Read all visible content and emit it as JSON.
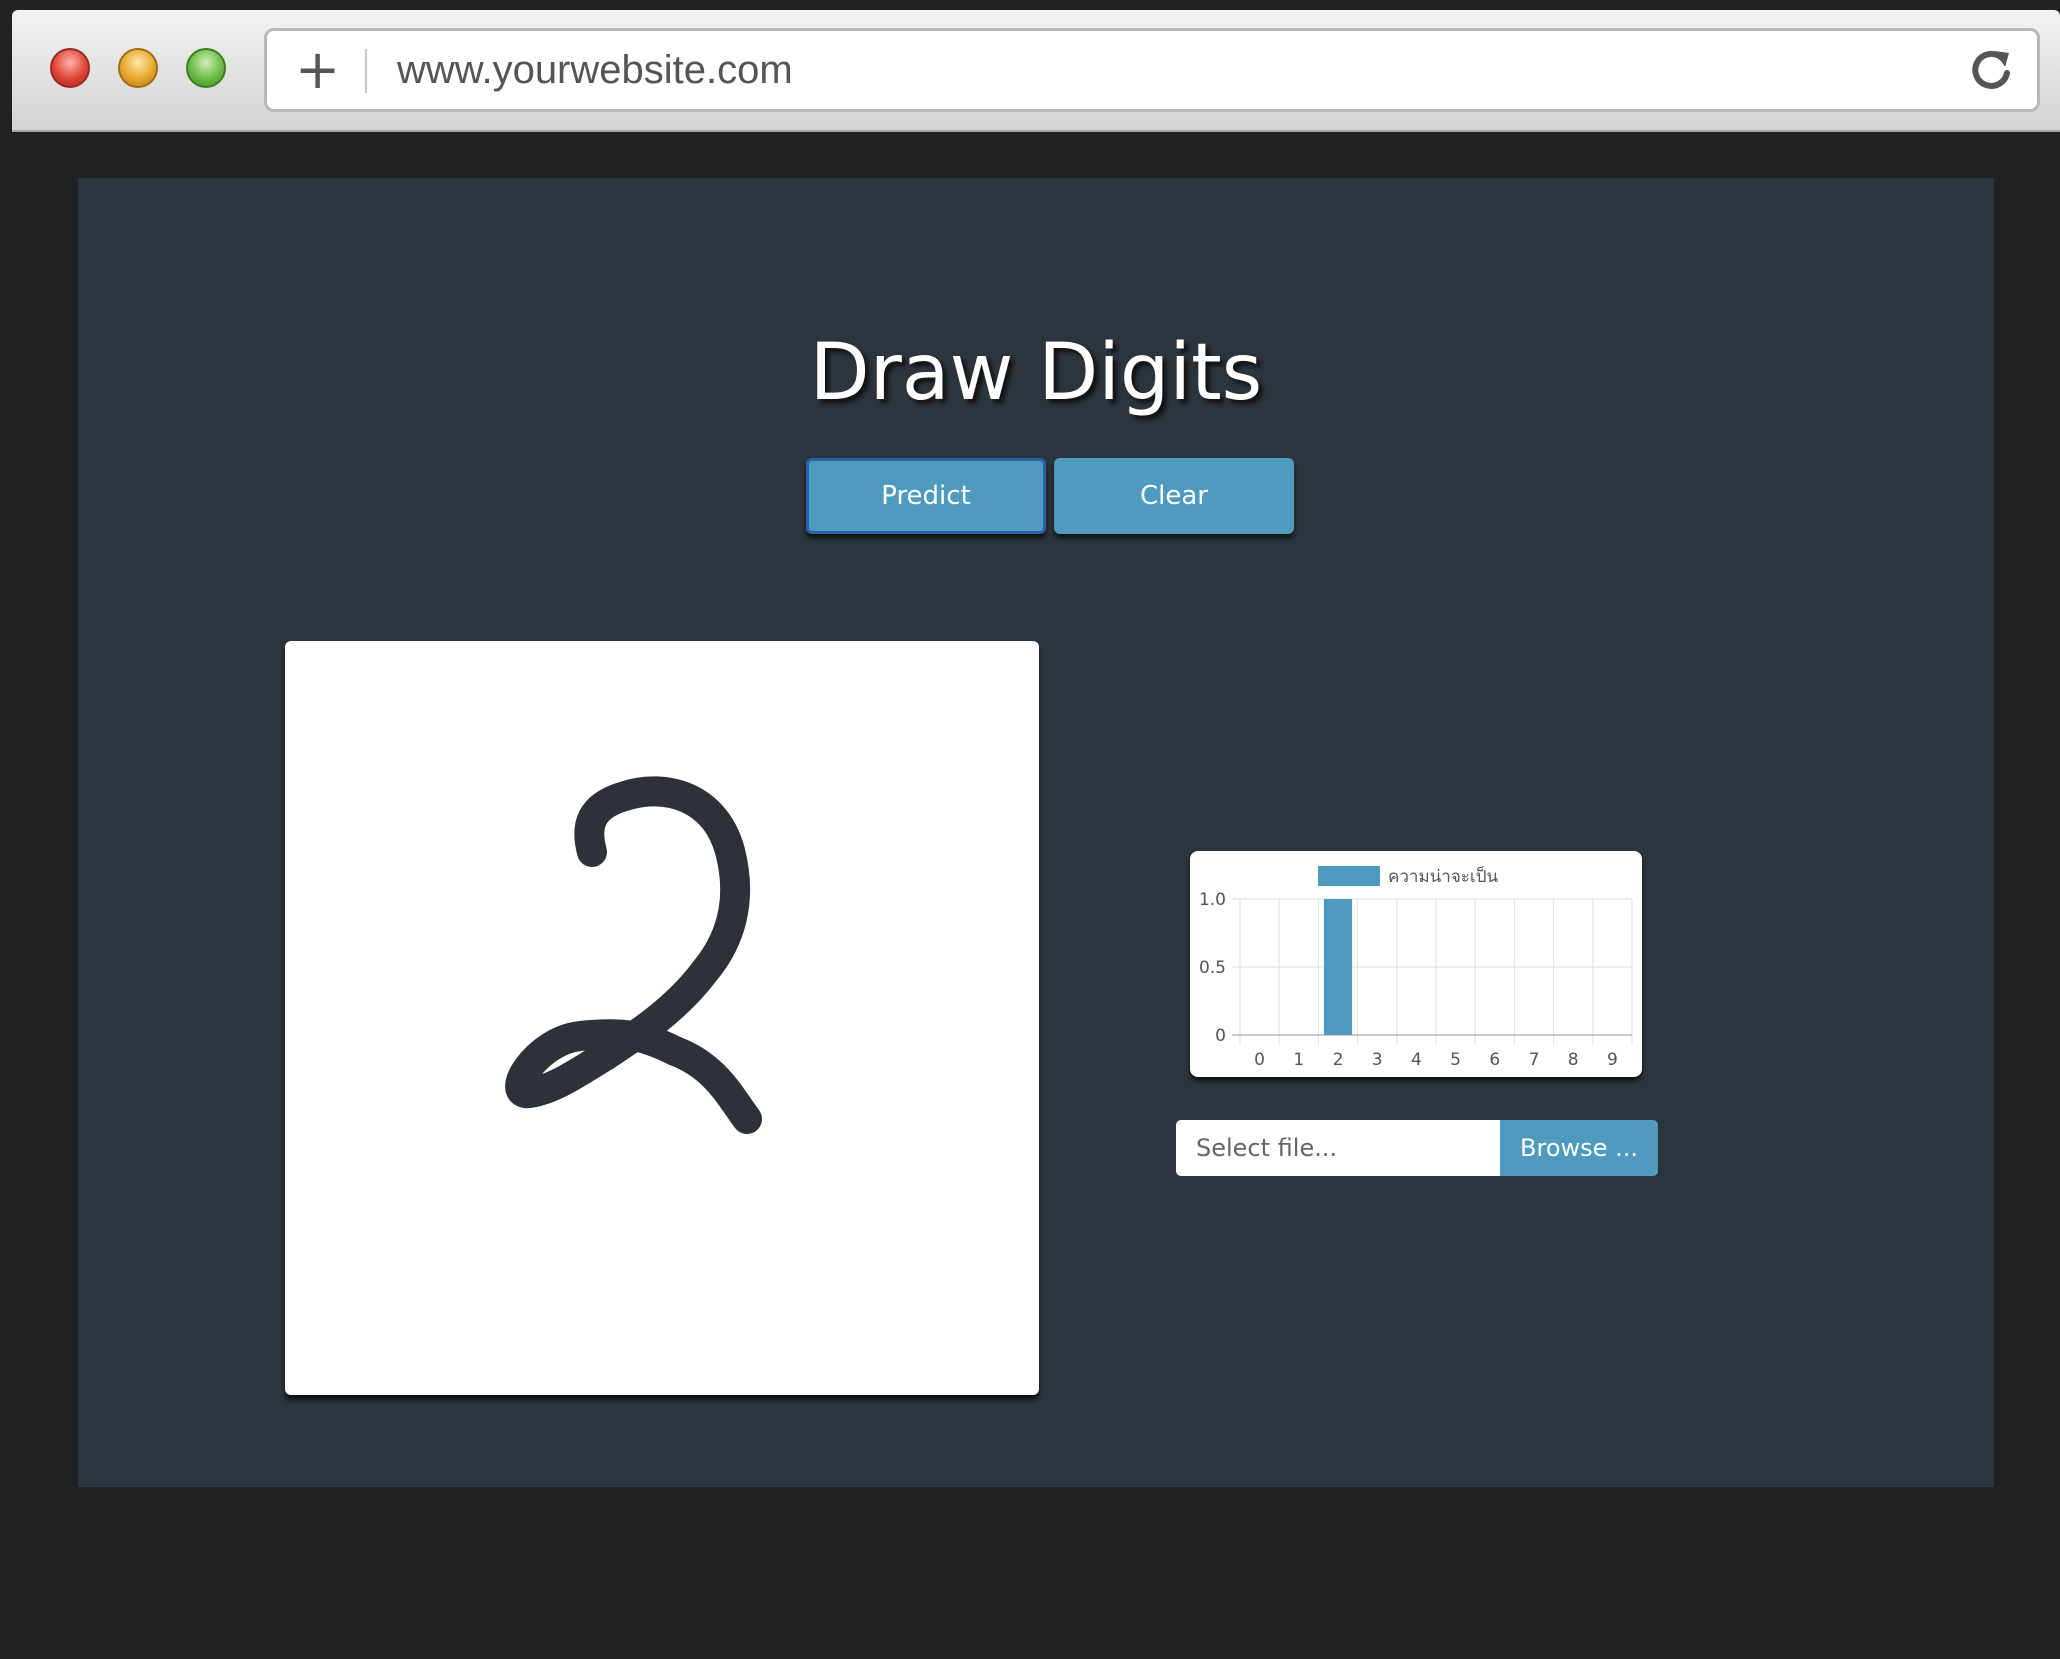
{
  "browser": {
    "url": "www.yourwebsite.com",
    "new_tab_symbol": "+",
    "traffic_lights": [
      "close",
      "minimize",
      "zoom"
    ],
    "icons": [
      "plus-icon",
      "reload-icon"
    ]
  },
  "app": {
    "title": "Draw Digits",
    "predict_label": "Predict",
    "clear_label": "Clear",
    "file_placeholder": "Select file...",
    "browse_label": "Browse ...",
    "drawn_digit": "2"
  },
  "colors": {
    "page_bg": "#2c353d",
    "accent": "#4f9bbf",
    "stroke": "#2c313a"
  },
  "chart_data": {
    "type": "bar",
    "categories": [
      "0",
      "1",
      "2",
      "3",
      "4",
      "5",
      "6",
      "7",
      "8",
      "9"
    ],
    "series": [
      {
        "name": "ความน่าจะเป็น",
        "values": [
          0,
          0,
          1.0,
          0,
          0,
          0,
          0,
          0,
          0,
          0
        ]
      }
    ],
    "ylim": [
      0,
      1.0
    ],
    "yticks": [
      "0",
      "0.5",
      "1.0"
    ],
    "grid": true,
    "legend": "top"
  }
}
